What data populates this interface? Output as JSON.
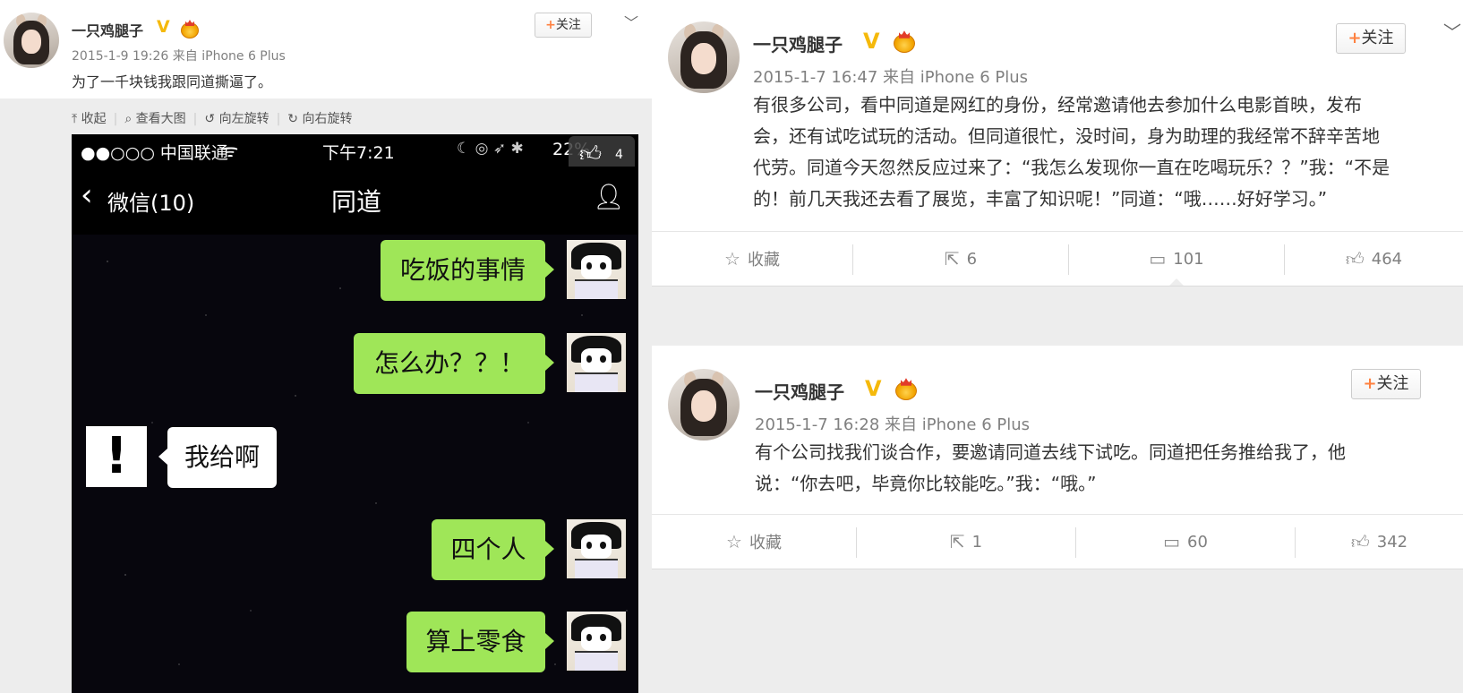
{
  "left_post": {
    "username": "一只鸡腿子",
    "verified": "V",
    "meta": "2015-1-9 19:26 来自 iPhone 6 Plus",
    "text": "为了一千块钱我跟同道撕逼了。",
    "follow_label": "关注",
    "follow_plus": "+",
    "toolbar": [
      "收起",
      "查看大图",
      "向左旋转",
      "向右旋转"
    ],
    "phone": {
      "carrier": "●●○○○ 中国联通",
      "time": "下午7:21",
      "battery": "22%",
      "back_label": "微信(10)",
      "chat_title": "同道",
      "like_count": "4",
      "messages": [
        {
          "from": "self",
          "text": "吃饭的事情"
        },
        {
          "from": "self",
          "text": "怎么办？？！"
        },
        {
          "from": "other",
          "text": "我给啊"
        },
        {
          "from": "self",
          "text": "四个人"
        },
        {
          "from": "self",
          "text": "算上零食"
        }
      ],
      "other_avatar_glyph": "!"
    }
  },
  "right_posts": [
    {
      "username": "一只鸡腿子",
      "verified": "V",
      "meta": "2015-1-7 16:47 来自 iPhone 6 Plus",
      "follow_label": "关注",
      "follow_plus": "+",
      "text_lines": [
        "有很多公司，看中同道是网红的身份，经常邀请他去参加什么电影首映，发布",
        "会，还有试吃试玩的活动。但同道很忙，没时间，身为助理的我经常不辞辛苦地",
        "代劳。同道今天忽然反应过来了：“我怎么发现你一直在吃喝玩乐？？”我：“不是",
        "的！前几天我还去看了展览，丰富了知识呢！”同道：“哦……好好学习。”"
      ],
      "actions": {
        "collect": "收藏",
        "repost": "6",
        "comment": "101",
        "like": "464"
      }
    },
    {
      "username": "一只鸡腿子",
      "verified": "V",
      "meta": "2015-1-7 16:28 来自 iPhone 6 Plus",
      "follow_label": "关注",
      "follow_plus": "+",
      "text_lines": [
        "有个公司找我们谈合作，要邀请同道去线下试吃。同道把任务推给我了，他",
        "说：“你去吧，毕竟你比较能吃。”我：“哦。”"
      ],
      "actions": {
        "collect": "收藏",
        "repost": "1",
        "comment": "60",
        "like": "342"
      }
    }
  ],
  "icons": {
    "collapse": "collapse-icon",
    "search": "search-icon",
    "rotate_left": "rotate-left-icon",
    "rotate_right": "rotate-right-icon",
    "star": "star-icon",
    "repost": "repost-icon",
    "comment": "comment-icon",
    "thumb": "thumb-up-icon",
    "chevron": "chevron-down-icon"
  },
  "colors": {
    "follow_plus": "#ff8140",
    "verified": "#f5b90b",
    "bubble_self": "#9fe658",
    "bubble_other": "#ffffff"
  }
}
